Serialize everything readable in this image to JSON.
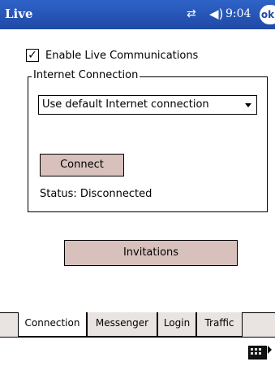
{
  "titlebar": {
    "title": "Live",
    "time": "9:04",
    "ok_label": "ok",
    "signal_icon": "connectivity-icon",
    "volume_icon": "speaker-icon"
  },
  "settings": {
    "enable_label": "Enable Live Communications",
    "enable_checked": true,
    "group_label": "Internet Connection",
    "connection_value": "Use default Internet connection",
    "connect_label": "Connect",
    "status_text": "Status: Disconnected",
    "invitations_label": "Invitations"
  },
  "tabs": [
    {
      "label": "Connection",
      "active": true
    },
    {
      "label": "Messenger",
      "active": false
    },
    {
      "label": "Login",
      "active": false
    },
    {
      "label": "Traffic",
      "active": false
    }
  ],
  "colors": {
    "titlebar": "#2f63c8",
    "button": "#d8c1bd",
    "tabbar": "#e9e3e1"
  },
  "cmdbar": {
    "keyboard_icon": "keyboard-icon"
  }
}
